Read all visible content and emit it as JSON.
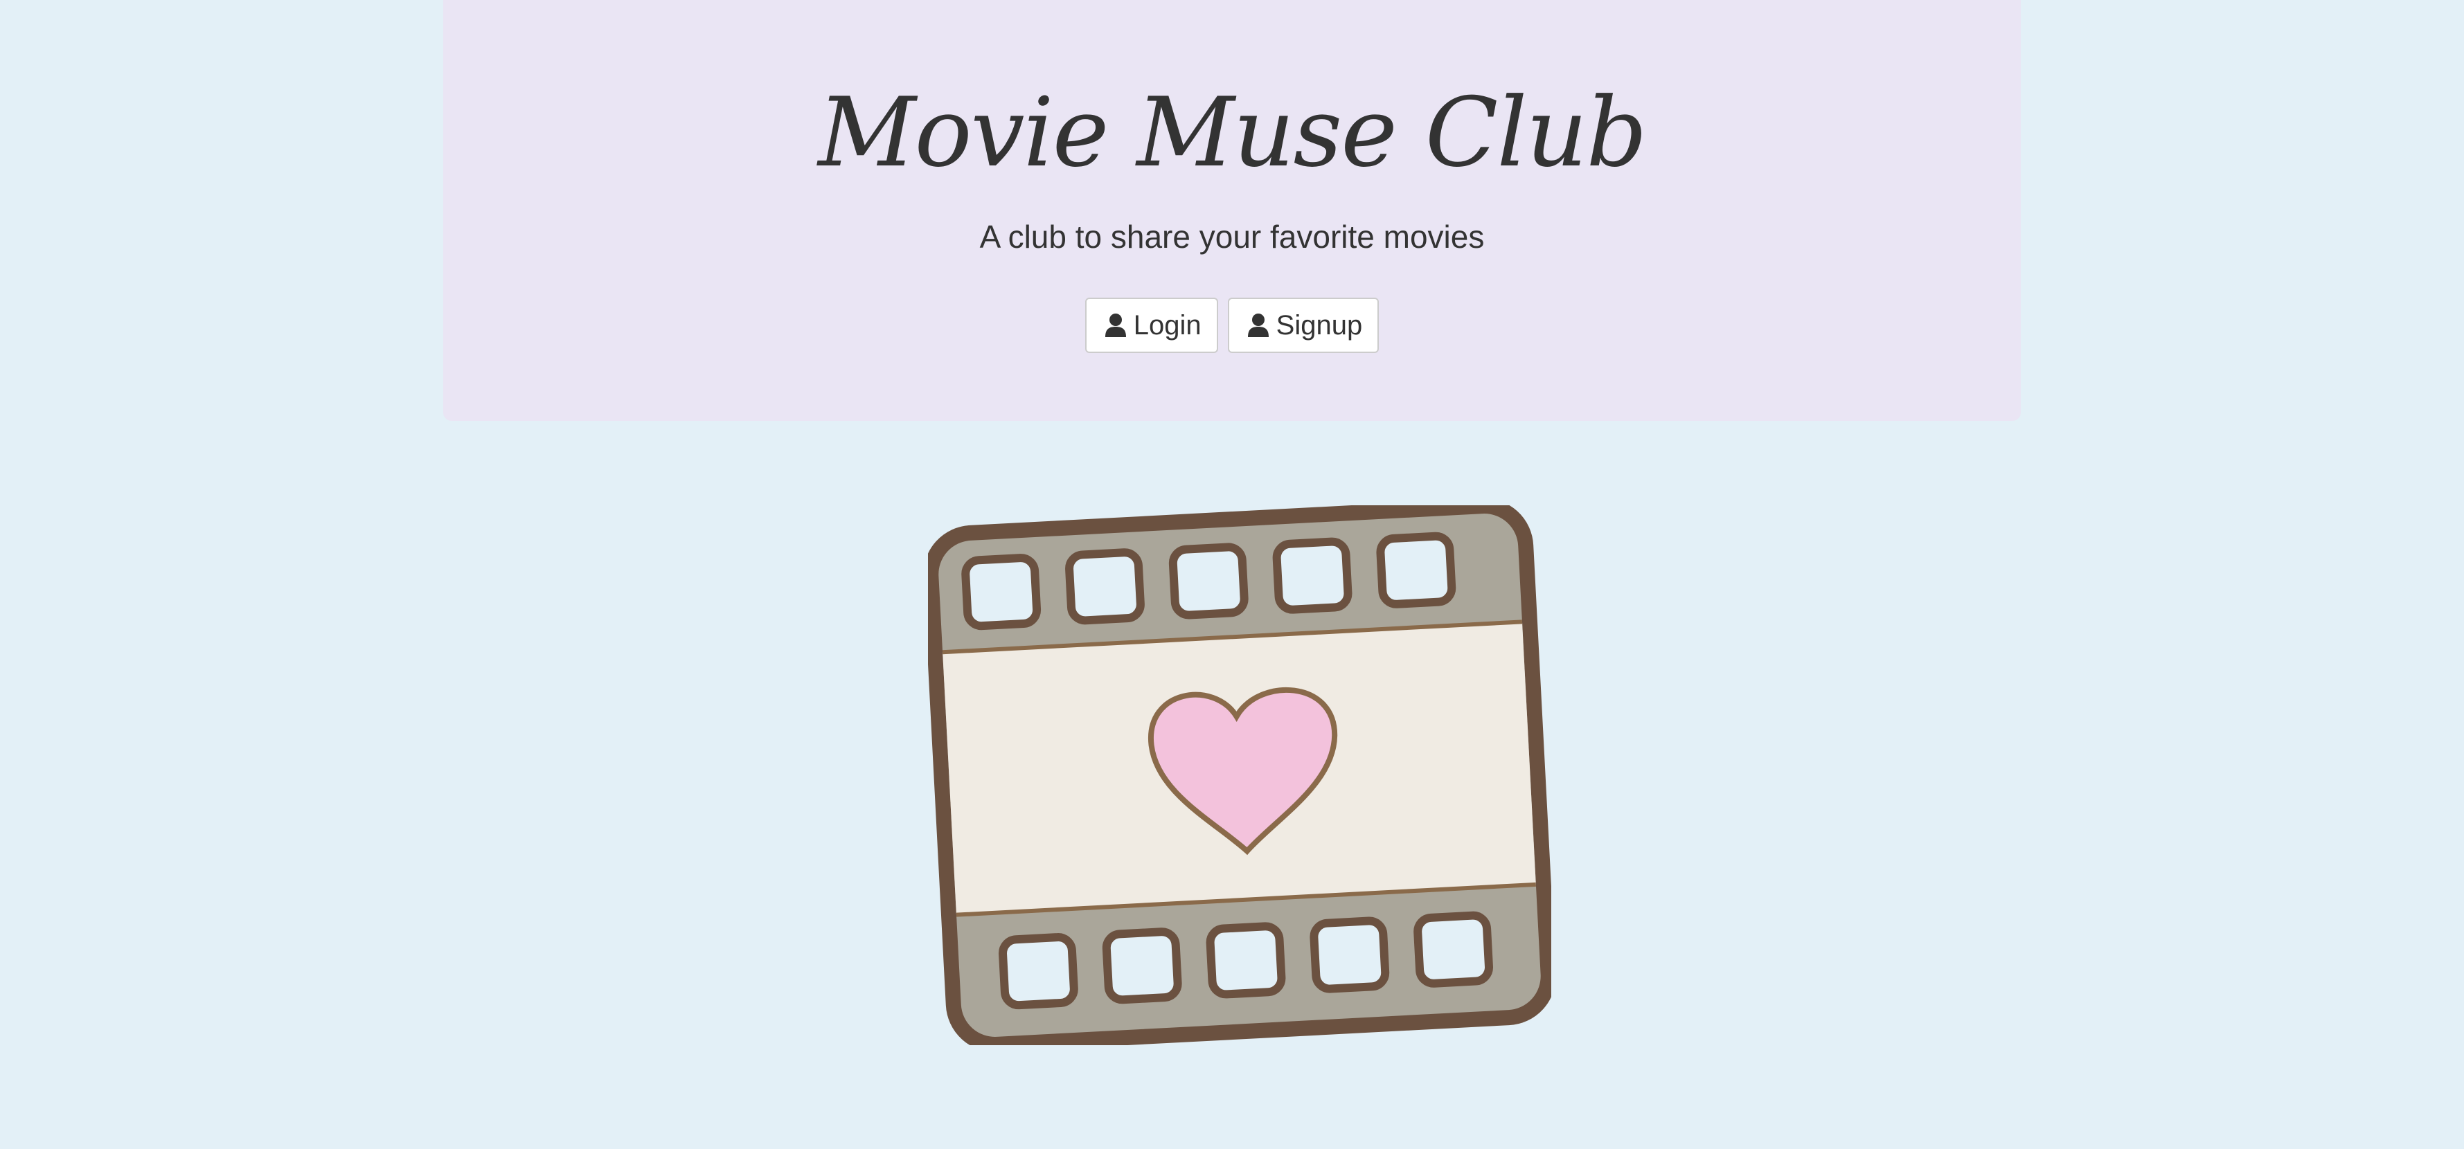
{
  "header": {
    "title": "Movie Muse Club",
    "subtitle": "A club to share your favorite movies"
  },
  "actions": {
    "login_label": "Login",
    "signup_label": "Signup",
    "login_icon": "user-icon",
    "signup_icon": "user-icon"
  },
  "hero_image": {
    "icon": "film-strip-heart-illustration"
  },
  "colors": {
    "page_background": "#e3f0f7",
    "jumbotron_background": "#eae5f4",
    "text": "#333333",
    "film_frame": "#6b5140",
    "film_strip": "#aaa69a",
    "film_center": "#f0ebe3",
    "heart": "#f3c2dc"
  }
}
